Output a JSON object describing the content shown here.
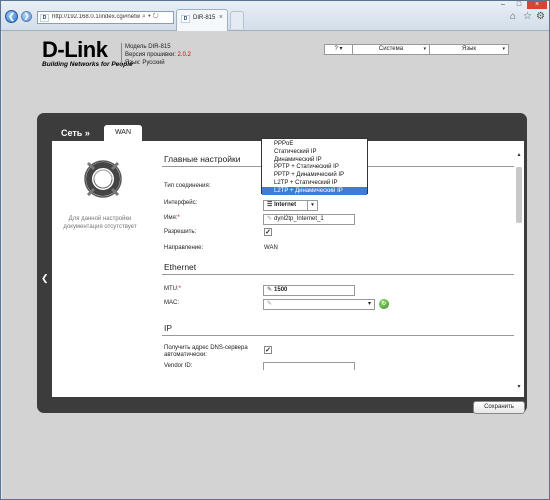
{
  "browser": {
    "url": "http://192.168.0.1/index.cgi#netw",
    "address_controls": "⌕ ▾ ↻",
    "tab_favicon": "D",
    "tab_title": "DIR-815",
    "tab_close": "×",
    "icons": [
      "home-icon",
      "star-icon",
      "gear-icon"
    ],
    "window_controls": {
      "minimize": "–",
      "maximize": "□",
      "close": "×"
    }
  },
  "header": {
    "logo_name": "D-Link",
    "logo_tagline": "Building Networks for People",
    "model_line": "Модель DIR-815",
    "firmware_label": "Версия прошивки:",
    "firmware_value": "2.0.2",
    "lang_line": "Язык: Русский",
    "menu": {
      "hint": "?",
      "system": "Система",
      "language": "Язык",
      "arrow": "▾"
    }
  },
  "nav": {
    "breadcrumb": "Сеть »",
    "tab": "WAN",
    "prev_arrow": "❮"
  },
  "sidebar": {
    "no_docs": "Для данной настройки документация отсутствует"
  },
  "form": {
    "main_section": "Главные настройки",
    "conn_type_label": "Тип соединения:",
    "interface_label": "Интерфейс:",
    "interface_value": "Internet",
    "name_label": "Имя:",
    "name_value": "dynl2tp_Internet_1",
    "allow_label": "Разрешить:",
    "direction_label": "Направление:",
    "direction_value": "WAN",
    "ethernet_section": "Ethernet",
    "mtu_label": "MTU:",
    "mtu_value": "1500",
    "mac_label": "MAC:",
    "ip_section": "IP",
    "dns_auto_label_1": "Получить адрес DNS-сервера",
    "dns_auto_label_2": "автоматически:",
    "vendor_label": "Vendor ID:",
    "required_mark": "*",
    "check_mark": "✓",
    "pen": "✎",
    "select_arrow": "▾",
    "refresh_glyph": "↻",
    "save": "Сохранить"
  },
  "connection_type_dropdown": {
    "options": [
      "PPPoE",
      "Статический IP",
      "Динамический IP",
      "PPTP + Статический IP",
      "PPTP + Динамический IP",
      "L2TP + Статический IP",
      "L2TP + Динамический IP"
    ],
    "selected": "L2TP + Динамический IP"
  },
  "colors": {
    "panel": "#3c3c3c",
    "selection": "#3a7fd4",
    "required": "#cc0000",
    "page_bg": "#d3d3d3"
  }
}
